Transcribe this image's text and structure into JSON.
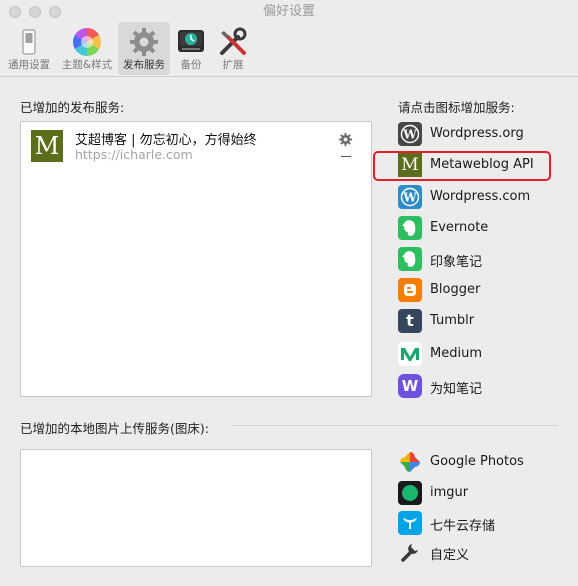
{
  "window": {
    "title": "偏好设置"
  },
  "toolbar": {
    "items": [
      {
        "label": "通用设置",
        "icon": "switch-icon"
      },
      {
        "label": "主题&样式",
        "icon": "color-wheel-icon"
      },
      {
        "label": "发布服务",
        "icon": "gear-icon",
        "active": true
      },
      {
        "label": "备份",
        "icon": "time-machine-icon"
      },
      {
        "label": "扩展",
        "icon": "tools-icon"
      }
    ]
  },
  "publish": {
    "added_label": "已增加的发布服务:",
    "add_hint": "请点击图标增加服务:",
    "account": {
      "logo_letter": "M",
      "name": "艾超博客 | 勿忘初心，方得始终",
      "url": "https://icharle.com"
    },
    "services": [
      {
        "label": "Wordpress.org",
        "icon": "wordpress-org-icon",
        "color": "#464646"
      },
      {
        "label": "Metaweblog API",
        "icon": "metaweblog-icon",
        "color": "#5c6d1b"
      },
      {
        "label": "Wordpress.com",
        "icon": "wordpress-com-icon",
        "color": "#2e8dc8"
      },
      {
        "label": "Evernote",
        "icon": "evernote-icon",
        "color": "#2dbe60"
      },
      {
        "label": "印象笔记",
        "icon": "yinxiang-icon",
        "color": "#2dbe60"
      },
      {
        "label": "Blogger",
        "icon": "blogger-icon",
        "color": "#f57d00"
      },
      {
        "label": "Tumblr",
        "icon": "tumblr-icon",
        "color": "#36465d"
      },
      {
        "label": "Medium",
        "icon": "medium-icon",
        "color": "#12a86e"
      },
      {
        "label": "为知笔记",
        "icon": "wiz-icon",
        "color": "#6f51df"
      }
    ]
  },
  "image_upload": {
    "added_label": "已增加的本地图片上传服务(图床):",
    "services": [
      {
        "label": "Google Photos",
        "icon": "google-photos-icon"
      },
      {
        "label": "imgur",
        "icon": "imgur-icon",
        "color": "#1bb76e"
      },
      {
        "label": "七牛云存储",
        "icon": "qiniu-icon",
        "color": "#00a3e8"
      },
      {
        "label": "自定义",
        "icon": "wrench-icon"
      }
    ]
  }
}
